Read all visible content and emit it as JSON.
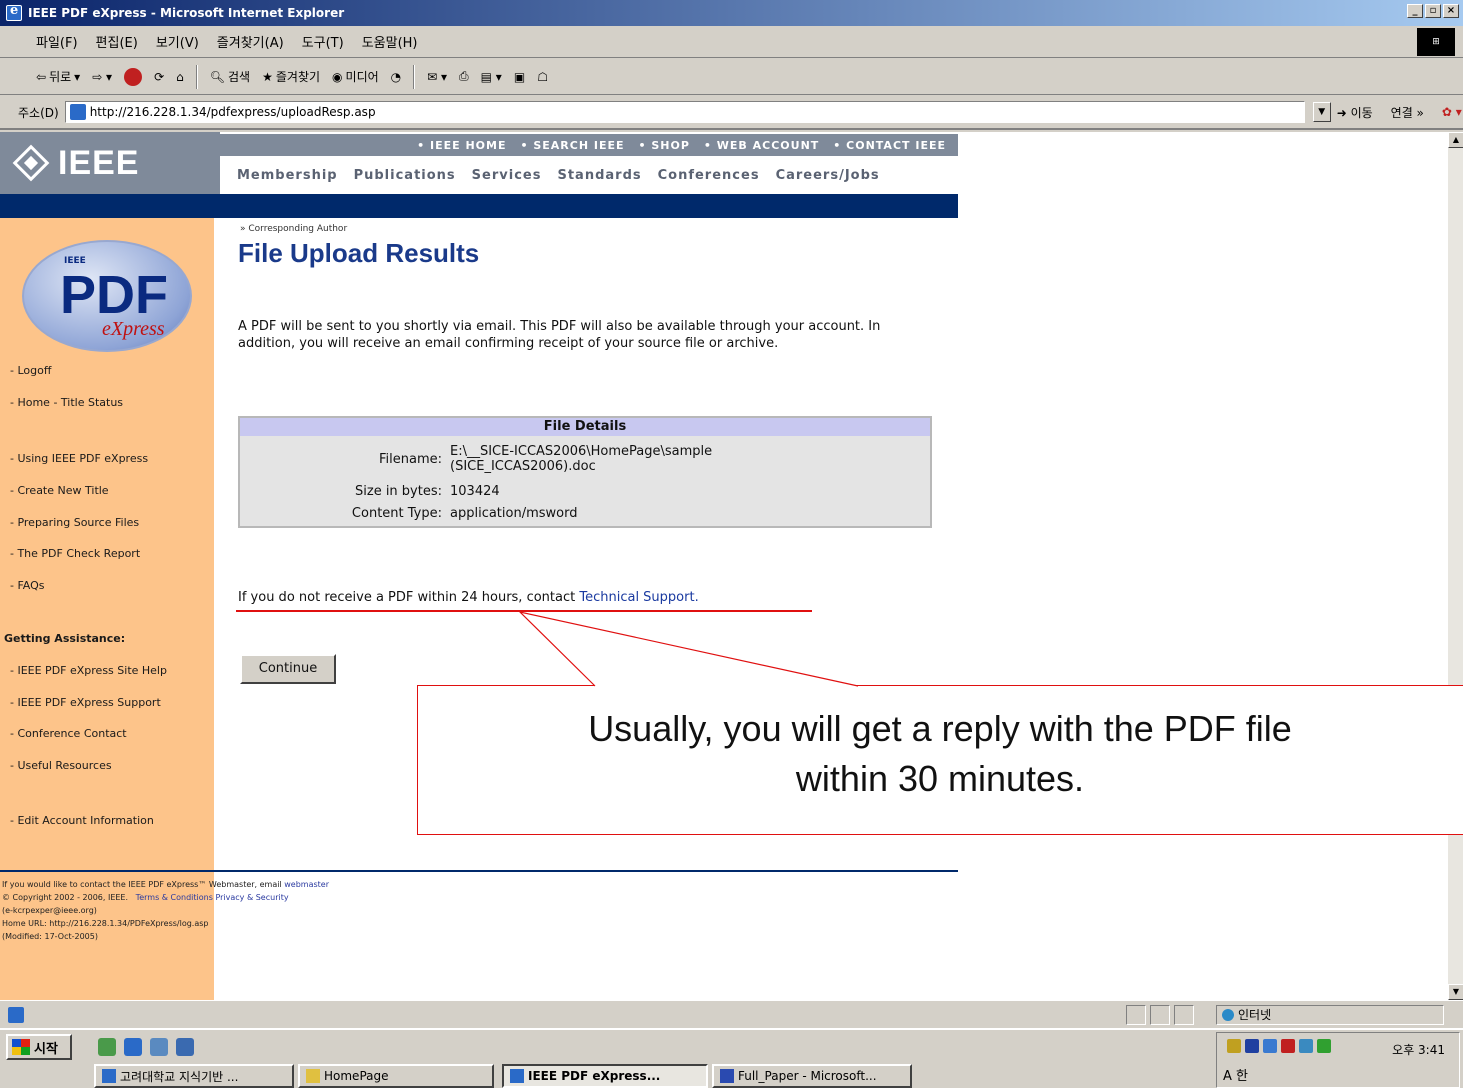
{
  "window": {
    "title": "IEEE PDF eXpress - Microsoft Internet Explorer",
    "btn_min": "_",
    "btn_max": "▫",
    "btn_close": "×"
  },
  "menu": {
    "items": [
      "파일(F)",
      "편집(E)",
      "보기(V)",
      "즐겨찾기(A)",
      "도구(T)",
      "도움말(H)"
    ]
  },
  "toolbar": {
    "back": "뒤로",
    "search": "검색",
    "favorites": "즐겨찾기",
    "media": "미디어"
  },
  "address": {
    "label": "주소(D)",
    "url": "http://216.228.1.34/pdfexpress/uploadResp.asp",
    "go": "이동",
    "links": "연결 »"
  },
  "ieee": {
    "logo": "IEEE",
    "top_nav": [
      "• IEEE HOME",
      "• SEARCH IEEE",
      "• SHOP",
      "• WEB ACCOUNT",
      "• CONTACT IEEE"
    ],
    "main_nav": [
      "Membership",
      "Publications",
      "Services",
      "Standards",
      "Conferences",
      "Careers/Jobs"
    ]
  },
  "sidebar": {
    "logo_ieee": "IEEE",
    "logo_pdf": "PDF",
    "logo_express": "eXpress",
    "links": [
      "- Logoff",
      "- Home - Title Status",
      "- Using IEEE PDF eXpress",
      "- Create New Title",
      "- Preparing Source Files",
      "- The PDF Check Report",
      "- FAQs"
    ],
    "assistance_heading": "Getting Assistance:",
    "assistance_links": [
      "- IEEE PDF eXpress Site Help",
      "- IEEE PDF eXpress Support",
      "- Conference Contact",
      "- Useful Resources"
    ],
    "account_link": "- Edit Account Information"
  },
  "content": {
    "breadcrumb": "» Corresponding Author",
    "title": "File Upload Results",
    "intro": "A PDF will be sent to you shortly via email. This PDF will also be available through your account. In addition, you will receive an email confirming receipt of your source file or archive.",
    "details": {
      "heading": "File Details",
      "filename_label": "Filename:",
      "filename_value": "E:\\__SICE-ICCAS2006\\HomePage\\sample (SICE_ICCAS2006).doc",
      "size_label": "Size in bytes:",
      "size_value": "103424",
      "type_label": "Content Type:",
      "type_value": "application/msword"
    },
    "notice_text": "If you do not receive a PDF within 24 hours, contact ",
    "notice_link": "Technical Support.",
    "continue_button": "Continue"
  },
  "footer": {
    "line1": "If you would like to contact the IEEE PDF eXpress™ Webmaster, email ",
    "line1_link": "webmaster",
    "line2": "© Copyright 2002 - 2006, IEEE.",
    "line2_links": "Terms & Conditions   Privacy & Security",
    "line3": "(e-kcrpexper@ieee.org)",
    "line4": "Home URL: http://216.228.1.34/PDFeXpress/log.asp",
    "line5": "(Modified: 17-Oct-2005)"
  },
  "callout": {
    "text_line1": "Usually, you will get a reply with the PDF file",
    "text_line2": "within 30 minutes."
  },
  "statusbar": {
    "zone": "인터넷"
  },
  "taskbar": {
    "start": "시작",
    "tasks": [
      "고려대학교 지식기반 ...",
      "HomePage",
      "IEEE PDF eXpress...",
      "Full_Paper - Microsoft..."
    ],
    "clock": "오후 3:41",
    "ime": "A 한"
  }
}
